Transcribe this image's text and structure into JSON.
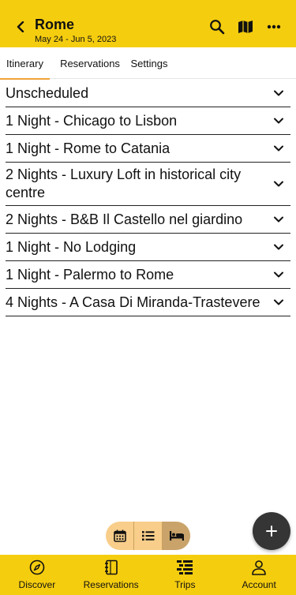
{
  "header": {
    "title": "Rome",
    "dates": "May 24 - Jun 5, 2023",
    "bg_color": "#f5cd0f",
    "icons": [
      "back-arrow",
      "search",
      "map",
      "more-horizontal"
    ]
  },
  "tabs": [
    {
      "label": "Itinerary",
      "active": true
    },
    {
      "label": "Reservations",
      "active": false
    },
    {
      "label": "Settings",
      "active": false
    }
  ],
  "items": [
    {
      "label": "Unscheduled"
    },
    {
      "label": "1 Night - Chicago to Lisbon"
    },
    {
      "label": "1 Night - Rome to Catania"
    },
    {
      "label": "2 Nights - Luxury Loft in historical city centre"
    },
    {
      "label": "2 Nights - B&B Il Castello nel giardino"
    },
    {
      "label": "1 Night - No Lodging"
    },
    {
      "label": "1 Night - Palermo to Rome"
    },
    {
      "label": "4 Nights - A Casa Di Miranda-Trastevere"
    }
  ],
  "view_toggle": {
    "options": [
      "calendar-icon",
      "list-icon",
      "bed-icon"
    ],
    "active": "bed-icon"
  },
  "fab": {
    "icon": "plus"
  },
  "bottom_nav": [
    {
      "label": "Discover",
      "icon": "compass-icon"
    },
    {
      "label": "Reservations",
      "icon": "notebook-icon"
    },
    {
      "label": "Trips",
      "icon": "trips-list-icon",
      "active": true
    },
    {
      "label": "Account",
      "icon": "person-icon"
    }
  ],
  "colors": {
    "accent": "#f5cd0f",
    "tab_underline": "#f0a23a",
    "toggle_bg": "#f8ce8a",
    "toggle_active": "#c9a36a",
    "fab": "#353535"
  }
}
